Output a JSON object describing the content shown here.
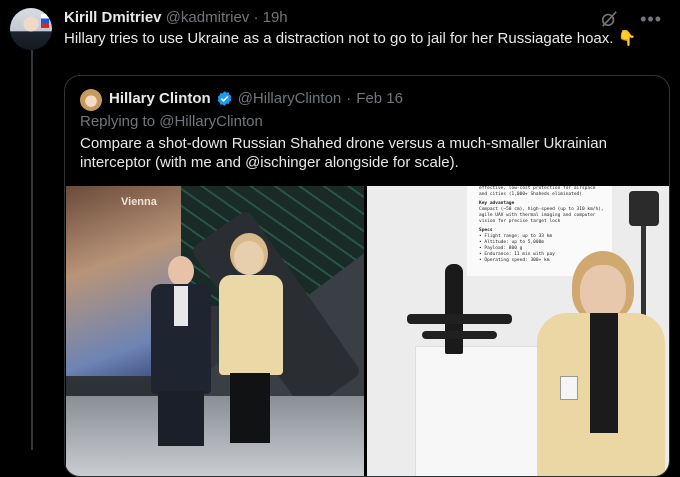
{
  "tweet": {
    "author_name": "Kirill Dmitriev",
    "author_handle": "@kadmitriev",
    "separator": "·",
    "time": "19h",
    "text": "Hillary tries to use Ukraine as a distraction not to go to jail for her Russiagate hoax. 👇"
  },
  "quote": {
    "author_name": "Hillary Clinton",
    "author_handle": "@HillaryClinton",
    "separator": "·",
    "date": "Feb 16",
    "replying_prefix": "Replying to",
    "replying_to": "@HillaryClinton",
    "text": "Compare a shot-down Russian Shahed drone versus a much-smaller Ukrainian interceptor (with me and @ischinger alongside for scale).",
    "photo_left": {
      "sign_text": "Vienna"
    },
    "photo_right": {
      "panel_line1": "effective, low-cost protection for airspace",
      "panel_line2": "and cities (1,000+ Shaheds eliminated)",
      "panel_heading1": "Key advantage",
      "panel_line3": "Compact (~50 cm), high-speed (up to 310 km/h),",
      "panel_line4": "agile UAV with thermal imaging and computer",
      "panel_line5": "vision for precise target lock",
      "panel_heading2": "Specs",
      "spec1": "• Flight range: up to 33 km",
      "spec2": "• Altitude: up to 5,000m",
      "spec3": "• Payload: 800 g",
      "spec4": "• Endurance: 11 min with pay",
      "spec5": "• Operating speed: 300+ km"
    }
  },
  "icons": {
    "grok": "grok-icon",
    "more": "more-icon",
    "verified": "verified-badge-icon"
  },
  "colors": {
    "background": "#000000",
    "text_primary": "#e7e9ea",
    "text_secondary": "#71767b",
    "border": "#2f3336",
    "verified": "#1d9bf0"
  }
}
